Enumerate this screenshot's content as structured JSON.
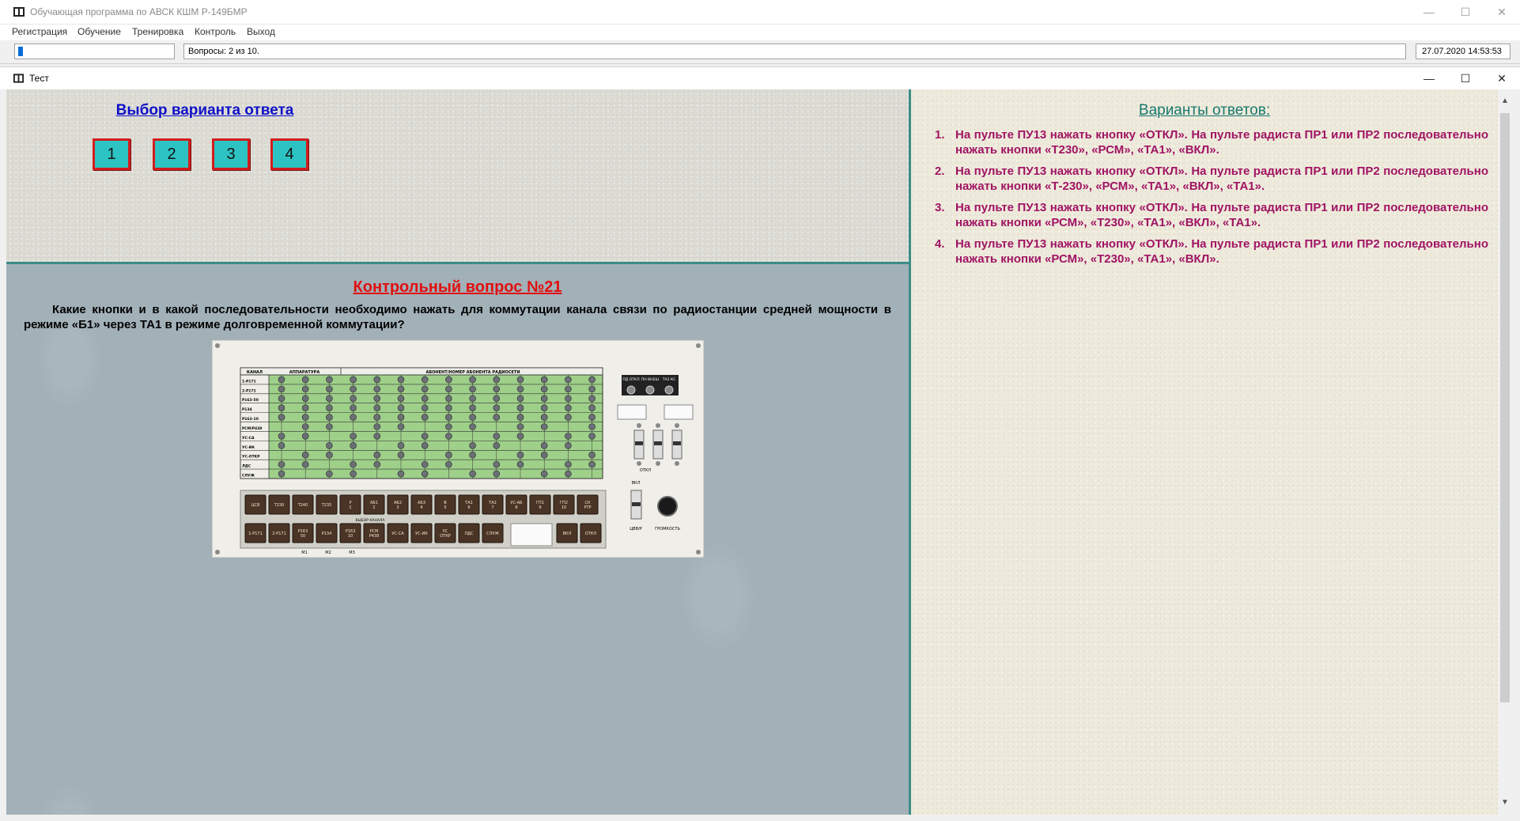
{
  "app": {
    "title": "Обучающая программа по АВСК КШМ Р-149БМР",
    "menu": [
      "Регистрация",
      "Обучение",
      "Тренировка",
      "Контроль",
      "Выход"
    ],
    "status": {
      "progress_fraction": 0.03,
      "questions": "Вопросы: 2 из 10.",
      "datetime": "27.07.2020 14:53:53"
    },
    "window_controls": {
      "minimize": "—",
      "maximize": "☐",
      "close": "✕"
    }
  },
  "test_window": {
    "title": "Тест",
    "window_controls": {
      "minimize": "—",
      "maximize": "☐",
      "close": "✕"
    }
  },
  "choice": {
    "title": "Выбор варианта ответа",
    "buttons": [
      "1",
      "2",
      "3",
      "4"
    ]
  },
  "question": {
    "heading": "Контрольный вопрос №21",
    "text": "Какие кнопки и в какой последовательности необходимо нажать для коммутации канала связи по радиостанции средней мощности в режиме «Б1» через ТА1 в режиме долговременной коммутации?"
  },
  "panel_image": {
    "header_channel": "КАНАЛ",
    "header_apparatus": "АППАРАТУРА",
    "header_subscriber": "АБОНЕНТ/НОМЕР АБОНЕНТА РАДИОСЕТИ",
    "rows": [
      "1-Р171",
      "2-Р171",
      "Р163-50",
      "Р134",
      "Р163-10",
      "РСМ/Р438",
      "УС-СА",
      "УС-ИК",
      "УС-ОТКР",
      "ЛДС",
      "СЛУЖ"
    ],
    "switch_labels": [
      "ПД ОТКЛ",
      "ПН ВНЕШ",
      "ТА2 КС"
    ],
    "otkl_label": "ОТКЛ",
    "vkl_label": "ВКЛ",
    "tsvr_label": "ЦВВ/Р",
    "volume_label": "ГРОМКОСТЬ",
    "select_channel_label": "ВЫБОР КАНАЛА",
    "top_buttons": [
      [
        "ЦСВ"
      ],
      [
        "Т230"
      ],
      [
        "Т240"
      ],
      [
        "Т235"
      ],
      [
        "Р",
        "1"
      ],
      [
        "АБ1",
        "2"
      ],
      [
        "АБ2",
        "3"
      ],
      [
        "АБ3",
        "4"
      ],
      [
        "В",
        "5"
      ],
      [
        "ТА1",
        "6"
      ],
      [
        "ТА2",
        "7"
      ],
      [
        "УС-АБ",
        "8"
      ],
      [
        "ГП1",
        "9"
      ],
      [
        "ГП2",
        "10"
      ],
      [
        "СК",
        "РТР"
      ]
    ],
    "bottom_buttons": [
      [
        "1-Р171"
      ],
      [
        "2-Р171"
      ],
      [
        "Р163",
        "50"
      ],
      [
        "Р134"
      ],
      [
        "Р163",
        "10"
      ],
      [
        "РСМ",
        "Р438"
      ],
      [
        "УС-СА"
      ],
      [
        "УС-ИК"
      ],
      [
        "УС",
        "ОТКР"
      ],
      [
        "ЛДС"
      ],
      [
        "СЛУЖ"
      ]
    ],
    "right_buttons": [
      "ВКЛ",
      "ОТКЛ"
    ],
    "bottom_marks": [
      "М1",
      "М2",
      "М3"
    ]
  },
  "answers": {
    "title": "Варианты ответов:",
    "items": [
      {
        "num": "1.",
        "text": "На пульте ПУ13 нажать кнопку «ОТКЛ». На пульте радиста ПР1 или ПР2 последовательно нажать кнопки «Т230», «РСМ», «ТА1», «ВКЛ»."
      },
      {
        "num": "2.",
        "text": "На пульте ПУ13 нажать кнопку «ОТКЛ». На пульте радиста ПР1 или ПР2 последовательно нажать кнопки «Т-230», «РСМ», «ТА1», «ВКЛ», «ТА1»."
      },
      {
        "num": "3.",
        "text": "На пульте ПУ13 нажать кнопку «ОТКЛ». На пульте радиста ПР1 или ПР2 последовательно нажать кнопки «РСМ», «Т230», «ТА1», «ВКЛ», «ТА1»."
      },
      {
        "num": "4.",
        "text": "На пульте ПУ13 нажать кнопку «ОТКЛ». На пульте радиста ПР1 или ПР2 последовательно нажать кнопки «РСМ», «Т230», «ТА1», «ВКЛ»."
      }
    ]
  },
  "scrollbar": {
    "up": "▲",
    "down": "▼"
  },
  "icons": {
    "app": "book-icon",
    "test_window": "book-icon"
  },
  "colors": {
    "choice_title": "#1010c8",
    "question_heading": "#e01010",
    "answers_title": "#17786f",
    "answers_text": "#a01464",
    "variant_button_fill": "#2ec3c3",
    "variant_button_border": "#d21d1d",
    "splitter": "#3c8c88"
  }
}
